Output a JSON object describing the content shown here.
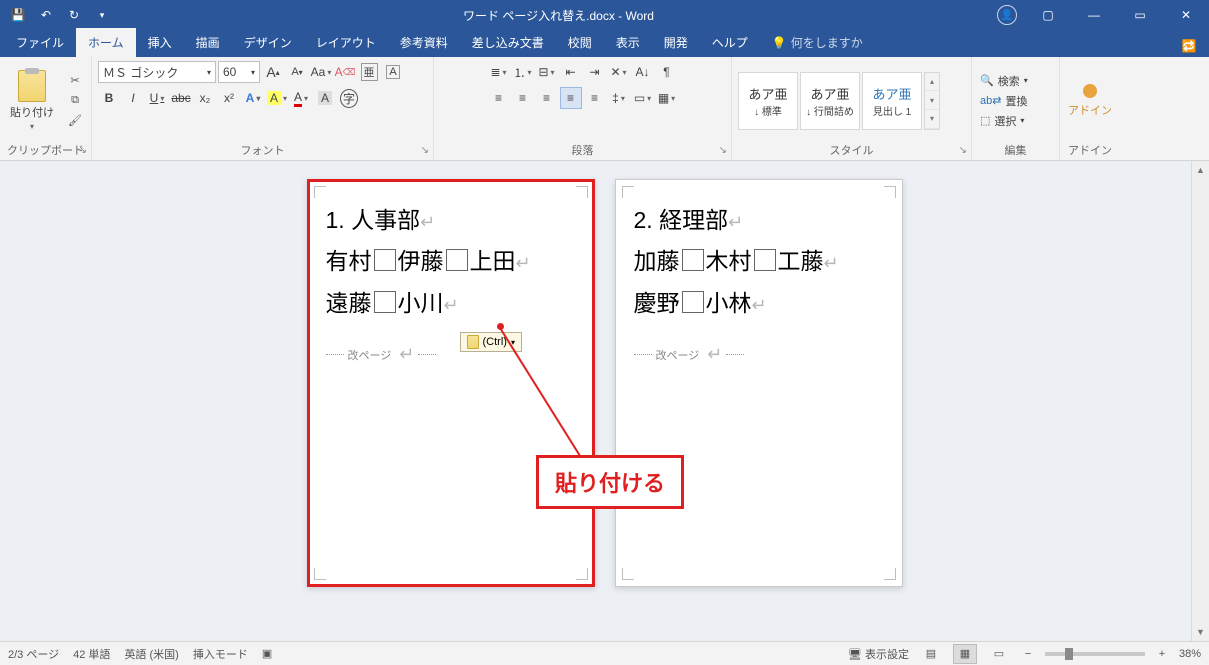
{
  "titlebar": {
    "doc_title": "ワード ページ入れ替え.docx  -  Word"
  },
  "tabs": {
    "file": "ファイル",
    "home": "ホーム",
    "insert": "挿入",
    "draw": "描画",
    "design": "デザイン",
    "layout": "レイアウト",
    "references": "参考資料",
    "mailings": "差し込み文書",
    "review": "校閲",
    "view": "表示",
    "developer": "開発",
    "help": "ヘルプ",
    "tell_me": "何をしますか"
  },
  "ribbon": {
    "clipboard": {
      "label": "クリップボード",
      "paste": "貼り付け"
    },
    "font": {
      "label": "フォント",
      "name": "ＭＳ ゴシック",
      "size": "60",
      "grow": "A",
      "shrink": "A",
      "case": "Aa",
      "clear": "A",
      "ruby": "亜",
      "charborder": "A",
      "bold": "B",
      "italic": "I",
      "underline": "U",
      "strike": "abc",
      "sub": "x₂",
      "sup": "x²",
      "texteffects": "A",
      "highlight": "A",
      "fontcolor": "A",
      "charshade": "A",
      "encircle": "字"
    },
    "paragraph": {
      "label": "段落"
    },
    "styles": {
      "label": "スタイル",
      "items": [
        {
          "sample": "あア亜",
          "name": "↓ 標準"
        },
        {
          "sample": "あア亜",
          "name": "↓ 行間詰め"
        },
        {
          "sample": "あア亜",
          "name": "見出し 1"
        }
      ]
    },
    "editing": {
      "label": "編集",
      "find": "検索",
      "replace": "置換",
      "select": "選択"
    },
    "addin": {
      "label": "アドイン",
      "btn": "アドイン"
    }
  },
  "doc": {
    "page1": {
      "heading": "1. 人事部",
      "line2a": "有村",
      "line2b": "伊藤",
      "line2c": "上田",
      "line3a": "遠藤",
      "line3b": "小川",
      "pagebreak": "改ページ"
    },
    "page2": {
      "heading": "2. 経理部",
      "line2a": "加藤",
      "line2b": "木村",
      "line2c": "工藤",
      "line3a": "慶野",
      "line3b": "小林",
      "pagebreak": "改ページ"
    },
    "paste_opts": "(Ctrl)",
    "callout": "貼り付ける"
  },
  "status": {
    "page": "2/3 ページ",
    "words": "42 単語",
    "lang": "英語 (米国)",
    "mode": "挿入モード",
    "display": "表示設定",
    "zoom": "38%"
  }
}
